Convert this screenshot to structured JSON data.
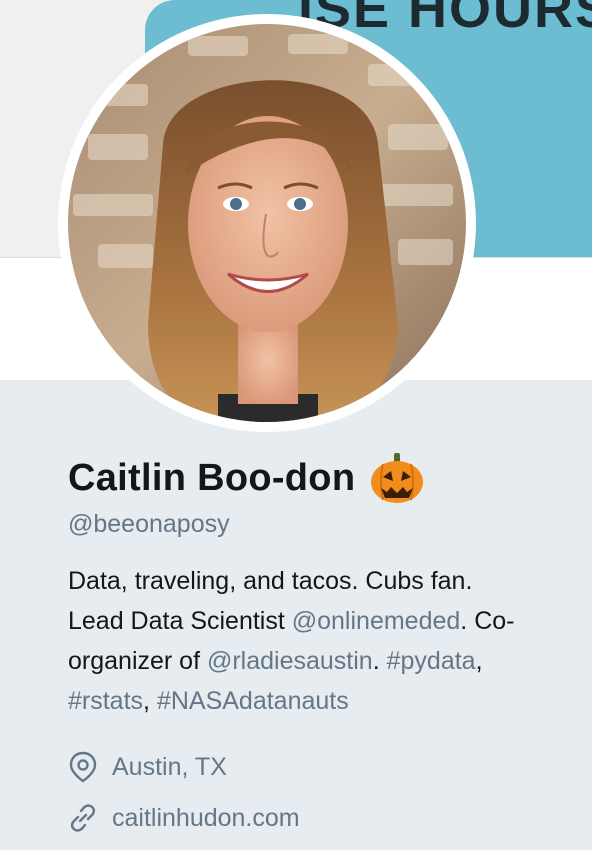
{
  "banner": {
    "text": "ISE HOURS"
  },
  "profile": {
    "name": "Caitlin Boo-don",
    "name_emoji": "jack-o-lantern-icon",
    "handle": "@beeonaposy",
    "bio": {
      "line1": "Data, traveling, and tacos. Cubs fan.",
      "lead_text": "Lead Data Scientist ",
      "mention_company": "@onlinemeded",
      "co_text": ". Co-",
      "organizer_text": "organizer of ",
      "mention_org": "@rladiesaustin",
      "sep1": ". ",
      "hashtag1": "#pydata",
      "comma1": ",",
      "hashtag2": "#rstats",
      "comma2": ", ",
      "hashtag3": "#NASAdatanauts"
    },
    "location": "Austin, TX",
    "website": "caitlinhudon.com"
  },
  "colors": {
    "link": "#657786",
    "text": "#14171a",
    "banner_blue": "#6cbdd2",
    "background": "#e6ecf0"
  }
}
